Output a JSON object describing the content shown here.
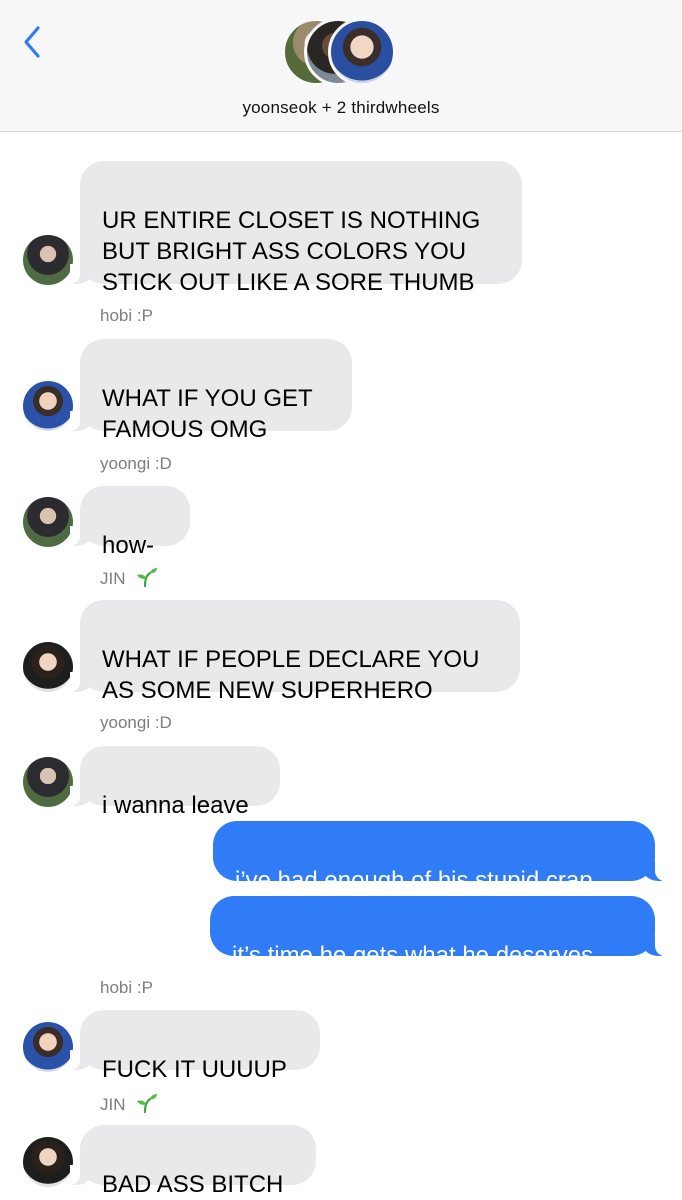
{
  "header": {
    "title": "yoonseok + 2 thirdwheels"
  },
  "icons": {
    "back": "chevron-left-icon",
    "sprout": "seedling-emoji"
  },
  "colors": {
    "outgoing_bubble": "#2f7cf6",
    "incoming_bubble": "#e9e9eb",
    "back_arrow": "#2f7cf6",
    "sender_label": "#7d7d82"
  },
  "messages": [
    {
      "from": "yoongi",
      "text": "UR ENTIRE CLOSET IS NOTHING\nBUT BRIGHT ASS COLORS YOU\nSTICK OUT LIKE A SORE THUMB"
    },
    {
      "sender_label": "hobi :P",
      "from": "hobi",
      "text": "WHAT IF YOU GET\nFAMOUS OMG"
    },
    {
      "sender_label": "yoongi :D",
      "from": "yoongi",
      "text": "how-"
    },
    {
      "sender_label": "JIN",
      "from": "jin",
      "text": "WHAT IF PEOPLE DECLARE YOU\nAS SOME NEW SUPERHERO"
    },
    {
      "sender_label": "yoongi :D",
      "from": "yoongi",
      "text": "i wanna leave"
    },
    {
      "from": "me",
      "text": "i’ve had enough of his stupid crap"
    },
    {
      "from": "me",
      "text": "it’s time he gets what he deserves"
    },
    {
      "sender_label": "hobi :P",
      "from": "hobi",
      "text": "FUCK IT UUUUP"
    },
    {
      "sender_label": "JIN",
      "from": "jin",
      "text": "BAD ASS BITCH"
    }
  ]
}
